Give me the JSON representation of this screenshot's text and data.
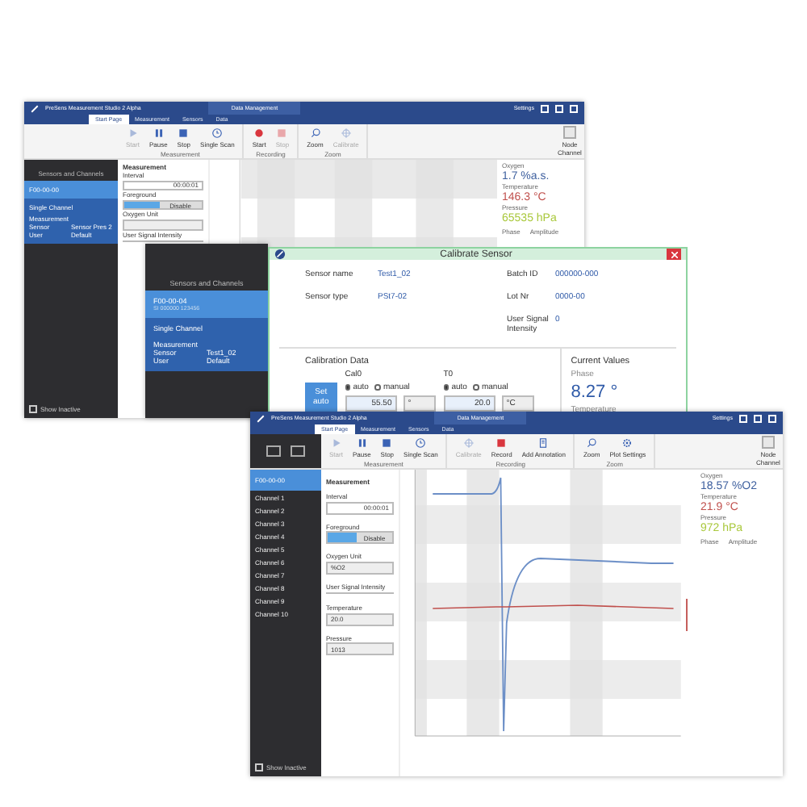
{
  "main_window": {
    "title": "PreSens Measurement Studio 2 Alpha",
    "context_tab": "Data Management",
    "menu_right": "Settings",
    "tabs": [
      {
        "label": "Start Page",
        "selected": true
      },
      {
        "label": "Measurement",
        "selected": false
      },
      {
        "label": "Sensors",
        "selected": false
      },
      {
        "label": "Data",
        "selected": false
      }
    ],
    "groups": [
      {
        "label": "Measurement",
        "items": [
          {
            "label": "Start",
            "kind": "play",
            "disabled": true
          },
          {
            "label": "Pause",
            "kind": "pause",
            "disabled": false
          },
          {
            "label": "Stop",
            "kind": "stop",
            "disabled": false
          },
          {
            "label": "Single Scan",
            "kind": "clock",
            "disabled": false
          }
        ]
      },
      {
        "label": "Recording",
        "items": [
          {
            "label": "Start",
            "kind": "record",
            "disabled": false
          },
          {
            "label": "Stop",
            "kind": "square",
            "disabled": true
          }
        ]
      },
      {
        "label": "Zoom",
        "items": [
          {
            "label": "Zoom",
            "kind": "zoom",
            "disabled": false
          },
          {
            "label": "Calibrate",
            "kind": "target",
            "disabled": true
          }
        ]
      }
    ],
    "right_button": "Node Channel",
    "sidebar": {
      "heading": "Sensors and Channels",
      "device": "F00-00-00",
      "channel": "Single Channel",
      "details": [
        {
          "label": "Measurement"
        },
        {
          "label": "Sensor",
          "value": "Sensor Pres 2"
        },
        {
          "label": "User",
          "value": "Default"
        }
      ],
      "footer": {
        "label": "Show Inactive",
        "checked": false
      }
    },
    "panel": {
      "heading": "Measurement",
      "fields": [
        {
          "label": "Interval",
          "kind": "input",
          "value": "00:00:01"
        },
        {
          "label": "Foreground",
          "kind": "toggle",
          "value": "Disable",
          "on": true
        },
        {
          "label": "Oxygen Unit",
          "kind": "select"
        },
        {
          "label": "User Signal Intensity",
          "kind": "slider"
        }
      ]
    },
    "readings": [
      {
        "label": "Oxygen",
        "value": "1.7 %a.s.",
        "color": "#3d5f9e"
      },
      {
        "label": "Temperature",
        "value": "146.3 °C",
        "color": "#c0504d"
      },
      {
        "label": "Pressure",
        "value": "65535 hPa",
        "color": "#a9c83b"
      }
    ],
    "reading_footer": [
      "Phase",
      "Amplitude"
    ]
  },
  "calibrate_window": {
    "sidebar": {
      "heading": "Sensors and Channels",
      "device": "F00-00-04",
      "device_id": "SI 000000 123456",
      "channel": "Single Channel",
      "details": [
        {
          "label": "Measurement"
        },
        {
          "label": "Sensor",
          "value": "Test1_02"
        },
        {
          "label": "User",
          "value": "Default"
        }
      ]
    },
    "title": "Calibrate Sensor",
    "info": [
      {
        "label": "Sensor name",
        "value": "Test1_02"
      },
      {
        "label": "Batch ID",
        "value": "000000-000"
      },
      {
        "label": "Sensor type",
        "value": "PSt7-02"
      },
      {
        "label": "Lot Nr",
        "value": "0000-00"
      },
      {
        "label": "User Signal Intensity",
        "value": "0"
      }
    ],
    "section": "Calibration Data",
    "button": "Set auto",
    "cal0": {
      "label": "Cal0",
      "options": [
        {
          "label": "auto",
          "selected": true
        },
        {
          "label": "manual",
          "selected": false
        }
      ],
      "value": "55.50",
      "unit": "°"
    },
    "t0": {
      "label": "T0",
      "options": [
        {
          "label": "auto",
          "selected": true
        },
        {
          "label": "manual",
          "selected": false
        }
      ],
      "value": "20.0",
      "unit": "°C"
    },
    "current": {
      "heading": "Current Values",
      "label": "Phase",
      "value": "8.27 °",
      "next_label": "Temperature"
    }
  },
  "chart_window": {
    "title": "PreSens Measurement Studio 2 Alpha",
    "context_tab": "Data Management",
    "menu_right": "Settings",
    "tabs": [
      {
        "label": "Start Page",
        "selected": true
      },
      {
        "label": "Measurement",
        "selected": false
      },
      {
        "label": "Sensors",
        "selected": false
      },
      {
        "label": "Data",
        "selected": false
      }
    ],
    "groups": [
      {
        "label": "Measurement",
        "items": [
          {
            "label": "Start",
            "kind": "play",
            "disabled": true
          },
          {
            "label": "Pause",
            "kind": "pause",
            "disabled": false
          },
          {
            "label": "Stop",
            "kind": "stop",
            "disabled": false
          },
          {
            "label": "Single Scan",
            "kind": "clock",
            "disabled": false
          }
        ]
      },
      {
        "label": "Recording",
        "items": [
          {
            "label": "Calibrate",
            "kind": "target",
            "disabled": true
          },
          {
            "label": "Record",
            "kind": "square",
            "disabled": false
          },
          {
            "label": "Add Annotation",
            "kind": "note",
            "disabled": false
          }
        ]
      },
      {
        "label": "Zoom",
        "items": [
          {
            "label": "Zoom",
            "kind": "zoom",
            "disabled": false
          },
          {
            "label": "Plot Settings",
            "kind": "gear",
            "disabled": false
          }
        ]
      }
    ],
    "right_button": "Node Channel",
    "channels": [
      {
        "label": "F00-00-00",
        "selected": true
      },
      {
        "label": "Channel 1",
        "selected": false
      },
      {
        "label": "Channel 2",
        "selected": false
      },
      {
        "label": "Channel 3",
        "selected": false
      },
      {
        "label": "Channel 4",
        "selected": false
      },
      {
        "label": "Channel 5",
        "selected": false
      },
      {
        "label": "Channel 6",
        "selected": false
      },
      {
        "label": "Channel 7",
        "selected": false
      },
      {
        "label": "Channel 8",
        "selected": false
      },
      {
        "label": "Channel 9",
        "selected": false
      },
      {
        "label": "Channel 10",
        "selected": false
      }
    ],
    "footer": {
      "label": "Show Inactive",
      "checked": false
    },
    "panel": {
      "heading": "Measurement",
      "fields": [
        {
          "label": "Interval",
          "kind": "input",
          "value": "00:00:01"
        },
        {
          "label": "Foreground",
          "kind": "toggle",
          "value": "Disable",
          "on": true
        },
        {
          "label": "Oxygen Unit",
          "kind": "select",
          "value": "%O2"
        },
        {
          "label": "User Signal Intensity",
          "kind": "slider"
        },
        {
          "label": "Temperature",
          "kind": "select",
          "value": "20.0"
        },
        {
          "label": "Pressure",
          "kind": "select",
          "value": "1013"
        }
      ]
    },
    "readings": [
      {
        "label": "Oxygen",
        "value": "18.57 %O2",
        "color": "#3d5f9e"
      },
      {
        "label": "Temperature",
        "value": "21.9 °C",
        "color": "#c0504d"
      },
      {
        "label": "Pressure",
        "value": "972 hPa",
        "color": "#a9c83b"
      }
    ],
    "reading_footer": [
      "Phase",
      "Amplitude"
    ]
  }
}
